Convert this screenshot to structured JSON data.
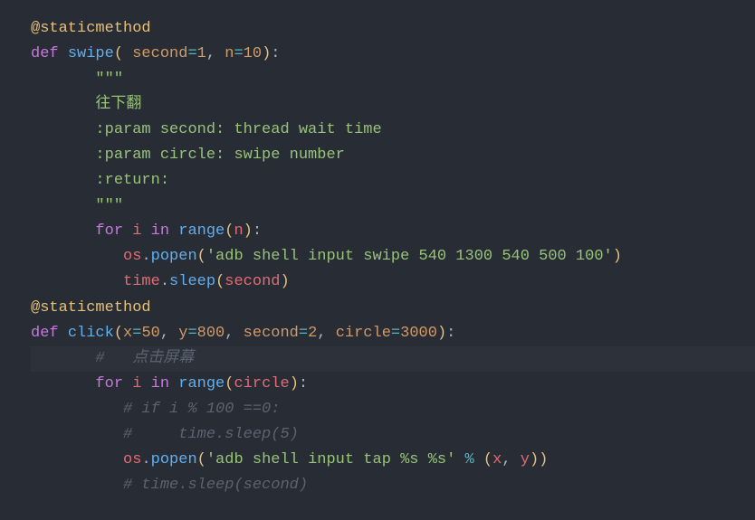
{
  "lines": {
    "l1_decor": "@staticmethod",
    "l2_def": "def",
    "l2_fn": "swipe",
    "l2_p1": " second",
    "l2_eq1": "=",
    "l2_v1": "1",
    "l2_c1": ", ",
    "l2_p2": "n",
    "l2_eq2": "=",
    "l2_v2": "10",
    "l2_colon": ":",
    "l3_quote": "\"\"\"",
    "l4_doc": "往下翻",
    "l5_doc": ":param second: thread wait time",
    "l6_doc": ":param circle: swipe number",
    "l7_doc": ":return:",
    "l8_quote": "\"\"\"",
    "l9_for": "for",
    "l9_i": "i",
    "l9_in": "in",
    "l9_range": "range",
    "l9_n": "n",
    "l9_colon": ":",
    "l10_os": "os",
    "l10_popen": "popen",
    "l10_str": "'adb shell input swipe 540 1300 540 500 100'",
    "l11_time": "time",
    "l11_sleep": "sleep",
    "l11_arg": "second",
    "l12_decor": "@staticmethod",
    "l13_def": "def",
    "l13_fn": "click",
    "l13_p1": "x",
    "l13_v1": "50",
    "l13_p2": "y",
    "l13_v2": "800",
    "l13_p3": "second",
    "l13_v3": "2",
    "l13_p4": "circle",
    "l13_v4": "3000",
    "l13_colon": ":",
    "l14_cmt": "#   点击屏幕",
    "l15_for": "for",
    "l15_i": "i",
    "l15_in": "in",
    "l15_range": "range",
    "l15_arg": "circle",
    "l15_colon": ":",
    "l16_cmt": "# if i % 100 ==0:",
    "l17_cmt": "#     time.sleep(5)",
    "l18_os": "os",
    "l18_popen": "popen",
    "l18_str": "'adb shell input tap %s %s'",
    "l18_pct": "%",
    "l18_x": "x",
    "l18_y": "y",
    "l19_cmt": "# time.sleep(second)"
  }
}
